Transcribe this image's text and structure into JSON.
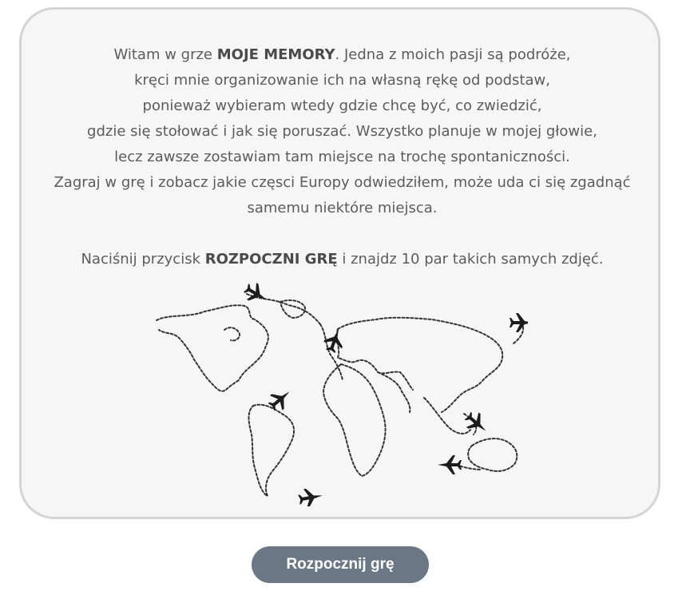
{
  "intro": {
    "p1_prefix": "Witam w grze ",
    "game_name": "MOJE MEMORY",
    "p1_suffix": ". Jedna z moich pasji są podróże,",
    "line2": "kręci mnie organizowanie ich na własną rękę od podstaw,",
    "line3": "ponieważ wybieram wtedy gdzie chcę być, co zwiedzić,",
    "line4": "gdzie się stołować i jak się poruszać. Wszystko planuje w mojej głowie,",
    "line5": "lecz zawsze zostawiam tam miejsce na trochę spontaniczności.",
    "line6": "Zagraj w grę i zobacz jakie częsci Europy odwiedziłem, może uda ci się zgadnąć",
    "line7": "samemu niektóre miejsca.",
    "instr_prefix": "Naciśnij przycisk ",
    "instr_button_name": "ROZPOCZNI GRĘ",
    "instr_suffix": " i znajdz 10 par takich samych zdjęć."
  },
  "map": {
    "icon": "world-map-with-airplanes"
  },
  "start_button": {
    "label": "Rozpocznij grę"
  },
  "colors": {
    "card_background": "#f6f6f6",
    "card_border": "#d4d4d4",
    "text": "#5c5c5c",
    "button_background": "#6c7786",
    "button_text": "#ffffff"
  }
}
